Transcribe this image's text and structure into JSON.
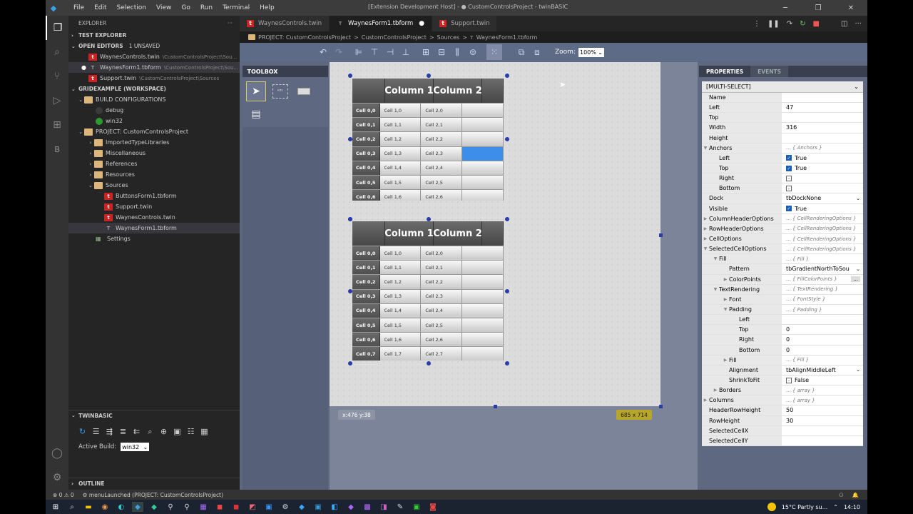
{
  "window": {
    "title": "[Extension Development Host] - ● CustomControlsProject - twinBASIC"
  },
  "menu": [
    "File",
    "Edit",
    "Selection",
    "View",
    "Go",
    "Run",
    "Terminal",
    "Help"
  ],
  "explorer": {
    "header": "EXPLORER",
    "test_explorer": "TEST EXPLORER",
    "open_editors": "OPEN EDITORS",
    "open_editors_badge": "1 UNSAVED",
    "open_files": [
      {
        "name": "WaynesControls.twin",
        "path": "\\CustomControlsProject\\Sou..."
      },
      {
        "name": "WaynesForm1.tbform",
        "path": "\\CustomControlsProject\\Sou..."
      },
      {
        "name": "Support.twin",
        "path": "\\CustomControlsProject\\Sources"
      }
    ],
    "workspace": "GRIDEXAMPLE (WORKSPACE)",
    "build_configs": "BUILD CONFIGURATIONS",
    "build_items": [
      "debug",
      "win32"
    ],
    "project": "PROJECT: CustomControlsProject",
    "folders": [
      "ImportedTypeLibraries",
      "Miscellaneous",
      "References",
      "Resources",
      "Sources"
    ],
    "sources": [
      "ButtonsForm1.tbform",
      "Support.twin",
      "WaynesControls.twin",
      "WaynesForm1.tbform"
    ],
    "settings": "Settings"
  },
  "twinbasic_panel": {
    "header": "TWINBASIC",
    "active_build_label": "Active Build:",
    "active_build_value": "win32",
    "outline": "OUTLINE"
  },
  "tabs": [
    {
      "label": "WaynesControls.twin"
    },
    {
      "label": "WaynesForm1.tbform"
    },
    {
      "label": "Support.twin"
    }
  ],
  "breadcrumb": [
    "PROJECT: CustomControlsProject",
    ">",
    "CustomControlsProject",
    ">",
    "Sources",
    ">",
    "WaynesForm1.tbform"
  ],
  "designer": {
    "zoom_label": "Zoom:",
    "zoom_value": "100%",
    "toolbox_title": "TOOLBOX",
    "coords": "x:476 y:38",
    "size": "685 x 714"
  },
  "grid1": {
    "columns": [
      "Column 1",
      "Column 2"
    ],
    "rows": [
      {
        "h": "Cell 0,0",
        "c1": "Cell 1,0",
        "c2": "Cell 2,0"
      },
      {
        "h": "Cell 0,1",
        "c1": "Cell 1,1",
        "c2": "Cell 2,1"
      },
      {
        "h": "Cell 0,2",
        "c1": "Cell 1,2",
        "c2": "Cell 2,2"
      },
      {
        "h": "Cell 0,3",
        "c1": "Cell 1,3",
        "c2": "Cell 2,3"
      },
      {
        "h": "Cell 0,4",
        "c1": "Cell 1,4",
        "c2": "Cell 2,4"
      },
      {
        "h": "Cell 0,5",
        "c1": "Cell 1,5",
        "c2": "Cell 2,5"
      },
      {
        "h": "Cell 0,6",
        "c1": "Cell 1,6",
        "c2": "Cell 2,6"
      }
    ]
  },
  "grid2": {
    "columns": [
      "Column 1",
      "Column 2"
    ],
    "rows": [
      {
        "h": "Cell 0,0",
        "c1": "Cell 1,0",
        "c2": "Cell 2,0"
      },
      {
        "h": "Cell 0,1",
        "c1": "Cell 1,1",
        "c2": "Cell 2,1"
      },
      {
        "h": "Cell 0,2",
        "c1": "Cell 1,2",
        "c2": "Cell 2,2"
      },
      {
        "h": "Cell 0,3",
        "c1": "Cell 1,3",
        "c2": "Cell 2,3"
      },
      {
        "h": "Cell 0,4",
        "c1": "Cell 1,4",
        "c2": "Cell 2,4"
      },
      {
        "h": "Cell 0,5",
        "c1": "Cell 1,5",
        "c2": "Cell 2,5"
      },
      {
        "h": "Cell 0,6",
        "c1": "Cell 1,6",
        "c2": "Cell 2,6"
      },
      {
        "h": "Cell 0,7",
        "c1": "Cell 1,7",
        "c2": "Cell 2,7"
      }
    ]
  },
  "properties": {
    "tab_properties": "PROPERTIES",
    "tab_events": "EVENTS",
    "selection": "[MULTI-SELECT]",
    "rows": [
      {
        "name": "Name",
        "value": "",
        "indent": 0,
        "type": "text"
      },
      {
        "name": "Left",
        "value": "47",
        "indent": 0,
        "type": "text"
      },
      {
        "name": "Top",
        "value": "",
        "indent": 0,
        "type": "text"
      },
      {
        "name": "Width",
        "value": "316",
        "indent": 0,
        "type": "text"
      },
      {
        "name": "Height",
        "value": "",
        "indent": 0,
        "type": "text"
      },
      {
        "name": "Anchors",
        "value": "... { Anchors }",
        "indent": 0,
        "type": "group",
        "open": true
      },
      {
        "name": "Left",
        "value": "True",
        "indent": 1,
        "type": "check",
        "checked": true
      },
      {
        "name": "Top",
        "value": "True",
        "indent": 1,
        "type": "check",
        "checked": true
      },
      {
        "name": "Right",
        "value": "",
        "indent": 1,
        "type": "check",
        "checked": false
      },
      {
        "name": "Bottom",
        "value": "",
        "indent": 1,
        "type": "check",
        "checked": false
      },
      {
        "name": "Dock",
        "value": "tbDockNone",
        "indent": 0,
        "type": "dropdown"
      },
      {
        "name": "Visible",
        "value": "True",
        "indent": 0,
        "type": "check",
        "checked": true
      },
      {
        "name": "ColumnHeaderOptions",
        "value": "... { CellRenderingOptions }",
        "indent": 0,
        "type": "group",
        "open": false
      },
      {
        "name": "RowHeaderOptions",
        "value": "... { CellRenderingOptions }",
        "indent": 0,
        "type": "group",
        "open": false
      },
      {
        "name": "CellOptions",
        "value": "... { CellRenderingOptions }",
        "indent": 0,
        "type": "group",
        "open": false
      },
      {
        "name": "SelectedCellOptions",
        "value": "... { CellRenderingOptions }",
        "indent": 0,
        "type": "group",
        "open": true
      },
      {
        "name": "Fill",
        "value": "... { Fill }",
        "indent": 1,
        "type": "group",
        "open": true
      },
      {
        "name": "Pattern",
        "value": "tbGradientNorthToSou",
        "indent": 2,
        "type": "dropdown"
      },
      {
        "name": "ColorPoints",
        "value": "... { FillColorPoints }",
        "indent": 2,
        "type": "group",
        "open": false,
        "more": "..."
      },
      {
        "name": "TextRendering",
        "value": "... { TextRendering }",
        "indent": 1,
        "type": "group",
        "open": true
      },
      {
        "name": "Font",
        "value": "... { FontStyle }",
        "indent": 2,
        "type": "group",
        "open": false
      },
      {
        "name": "Padding",
        "value": "... { Padding }",
        "indent": 2,
        "type": "group",
        "open": true
      },
      {
        "name": "Left",
        "value": "",
        "indent": 3,
        "type": "text"
      },
      {
        "name": "Top",
        "value": "0",
        "indent": 3,
        "type": "text"
      },
      {
        "name": "Right",
        "value": "0",
        "indent": 3,
        "type": "text"
      },
      {
        "name": "Bottom",
        "value": "0",
        "indent": 3,
        "type": "text"
      },
      {
        "name": "Fill",
        "value": "... { Fill }",
        "indent": 2,
        "type": "group",
        "open": false
      },
      {
        "name": "Alignment",
        "value": "tbAlignMiddleLeft",
        "indent": 2,
        "type": "dropdown"
      },
      {
        "name": "ShrinkToFit",
        "value": "False",
        "indent": 2,
        "type": "check",
        "checked": false
      },
      {
        "name": "Borders",
        "value": "... { array }",
        "indent": 1,
        "type": "group",
        "open": false
      },
      {
        "name": "Columns",
        "value": "... { array }",
        "indent": 0,
        "type": "group",
        "open": false
      },
      {
        "name": "HeaderRowHeight",
        "value": "50",
        "indent": 0,
        "type": "text"
      },
      {
        "name": "RowHeight",
        "value": "30",
        "indent": 0,
        "type": "text"
      },
      {
        "name": "SelectedCellX",
        "value": "",
        "indent": 0,
        "type": "text"
      },
      {
        "name": "SelectedCellY",
        "value": "",
        "indent": 0,
        "type": "text"
      }
    ]
  },
  "statusbar": {
    "problems": "0 ⚠ 0",
    "message": "menuLaunched (PROJECT: CustomControlsProject)"
  },
  "taskbar": {
    "weather": "15°C  Partly su...",
    "time": "14:10"
  }
}
